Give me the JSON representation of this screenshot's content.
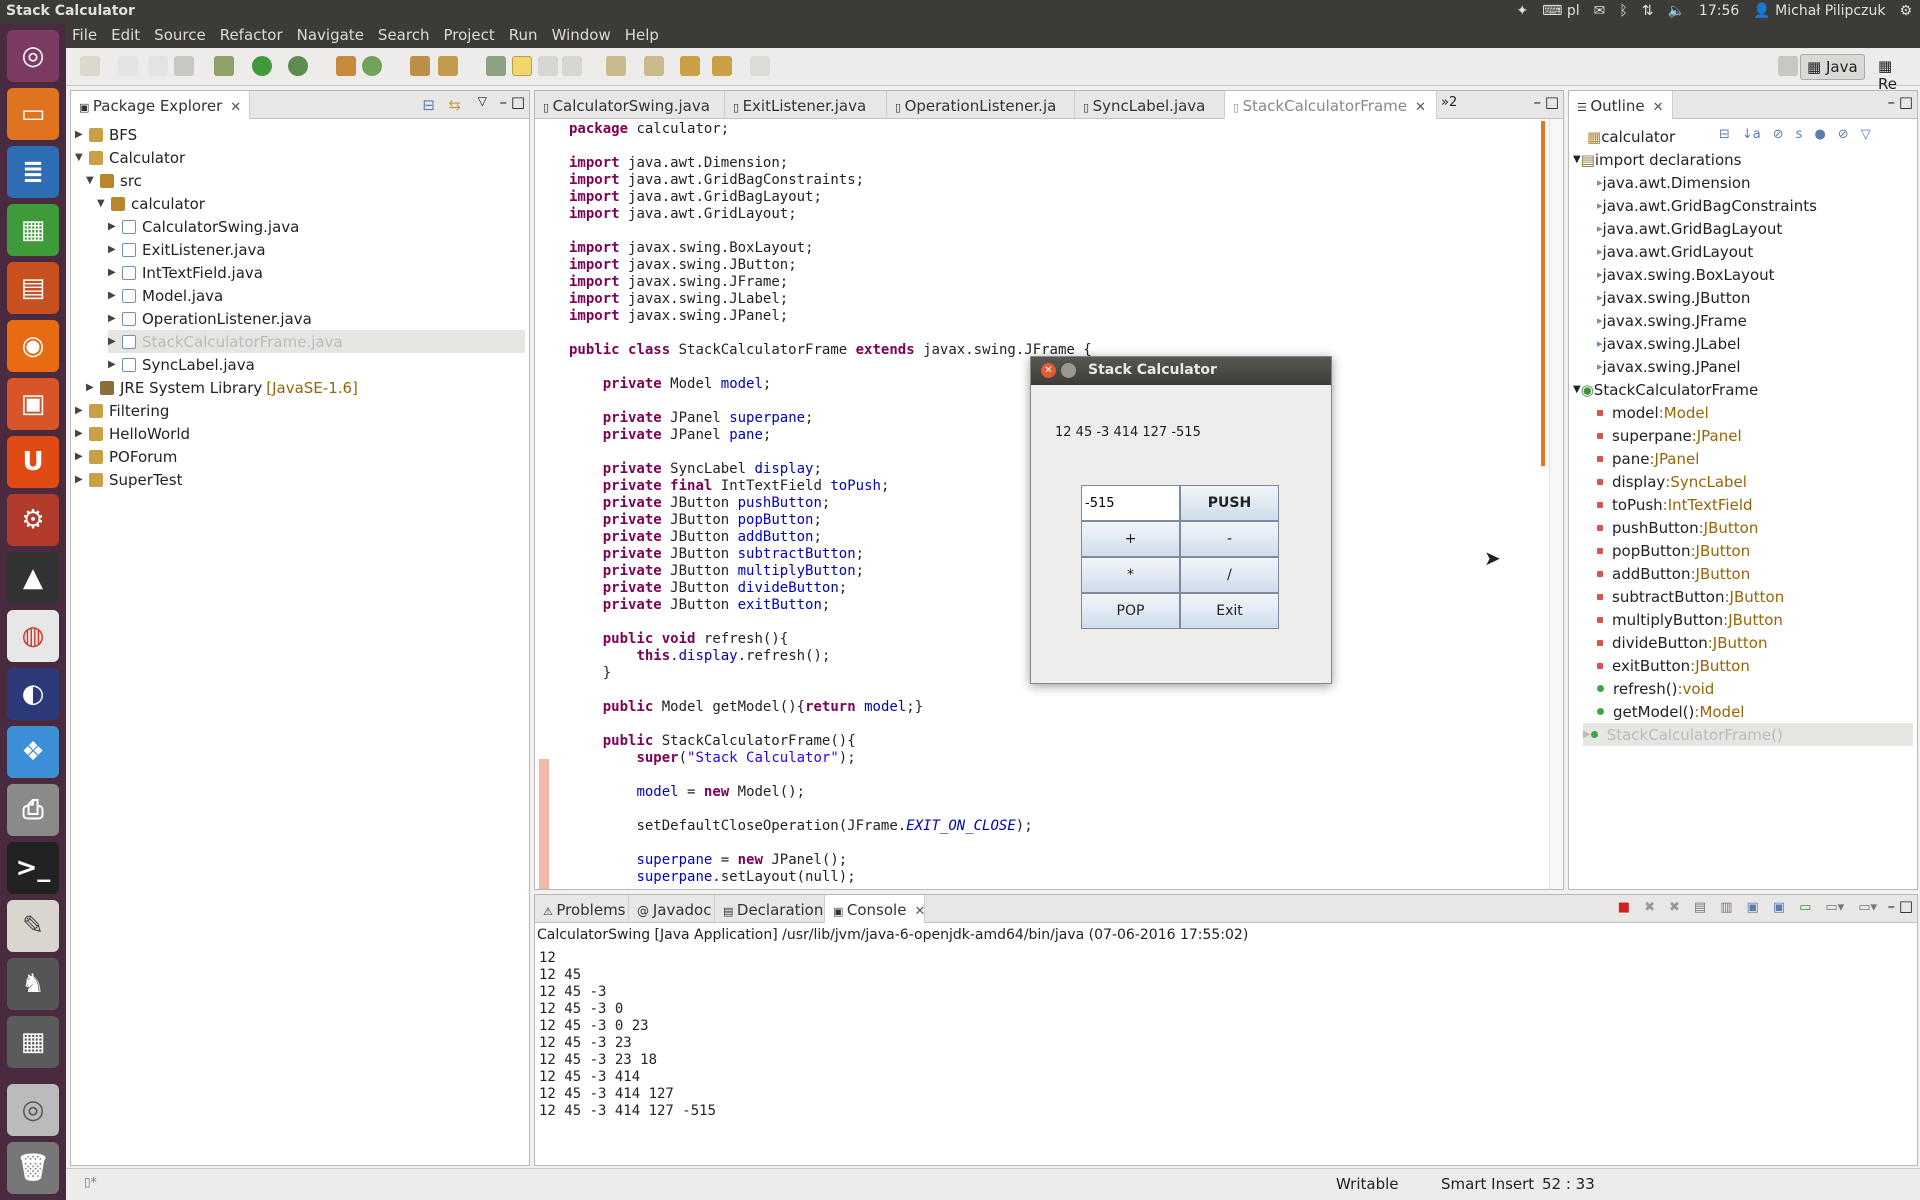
{
  "topbar": {
    "title": "Stack Calculator",
    "lang": "pl",
    "time": "17:56",
    "user": "Michał Pilipczuk"
  },
  "menu": [
    "File",
    "Edit",
    "Source",
    "Refactor",
    "Navigate",
    "Search",
    "Project",
    "Run",
    "Window",
    "Help"
  ],
  "perspectives": {
    "java": "Java",
    "re": "Re"
  },
  "package_explorer": {
    "title": "Package Explorer",
    "rows": [
      {
        "indent": 0,
        "tw": "▶",
        "icon": "proj",
        "label": "BFS"
      },
      {
        "indent": 0,
        "tw": "▼",
        "icon": "proj",
        "label": "Calculator"
      },
      {
        "indent": 1,
        "tw": "▼",
        "icon": "pkg",
        "label": "src"
      },
      {
        "indent": 2,
        "tw": "▼",
        "icon": "pkg",
        "label": "calculator"
      },
      {
        "indent": 3,
        "tw": "▶",
        "icon": "java",
        "label": "CalculatorSwing.java"
      },
      {
        "indent": 3,
        "tw": "▶",
        "icon": "java",
        "label": "ExitListener.java"
      },
      {
        "indent": 3,
        "tw": "▶",
        "icon": "java",
        "label": "IntTextField.java"
      },
      {
        "indent": 3,
        "tw": "▶",
        "icon": "java",
        "label": "Model.java"
      },
      {
        "indent": 3,
        "tw": "▶",
        "icon": "java",
        "label": "OperationListener.java"
      },
      {
        "indent": 3,
        "tw": "▶",
        "icon": "java",
        "label": "StackCalculatorFrame.java",
        "selected": true
      },
      {
        "indent": 3,
        "tw": "▶",
        "icon": "java",
        "label": "SyncLabel.java"
      },
      {
        "indent": 1,
        "tw": "▶",
        "icon": "lib",
        "label": "JRE System Library",
        "suffix": "[JavaSE-1.6]"
      },
      {
        "indent": 0,
        "tw": "▶",
        "icon": "proj",
        "label": "Filtering"
      },
      {
        "indent": 0,
        "tw": "▶",
        "icon": "proj",
        "label": "HelloWorld"
      },
      {
        "indent": 0,
        "tw": "▶",
        "icon": "proj",
        "label": "POForum"
      },
      {
        "indent": 0,
        "tw": "▶",
        "icon": "proj",
        "label": "SuperTest"
      }
    ]
  },
  "editor_tabs": [
    "CalculatorSwing.java",
    "ExitListener.java",
    "OperationListener.ja",
    "SyncLabel.java",
    "StackCalculatorFrame"
  ],
  "editor_more": "»2",
  "code_lines": [
    "package calculator;",
    "",
    "import java.awt.Dimension;",
    "import java.awt.GridBagConstraints;",
    "import java.awt.GridBagLayout;",
    "import java.awt.GridLayout;",
    "",
    "import javax.swing.BoxLayout;",
    "import javax.swing.JButton;",
    "import javax.swing.JFrame;",
    "import javax.swing.JLabel;",
    "import javax.swing.JPanel;",
    "",
    "public class StackCalculatorFrame extends javax.swing.JFrame {",
    "",
    "    private Model model;",
    "",
    "    private JPanel superpane;",
    "    private JPanel pane;",
    "",
    "    private SyncLabel display;",
    "    private final IntTextField toPush;",
    "    private JButton pushButton;",
    "    private JButton popButton;",
    "    private JButton addButton;",
    "    private JButton subtractButton;",
    "    private JButton multiplyButton;",
    "    private JButton divideButton;",
    "    private JButton exitButton;",
    "",
    "    public void refresh(){",
    "        this.display.refresh();",
    "    }",
    "",
    "    public Model getModel(){return model;}",
    "",
    "    public StackCalculatorFrame(){",
    "        super(\"Stack Calculator\");",
    "",
    "        model = new Model();",
    "",
    "        setDefaultCloseOperation(JFrame.EXIT_ON_CLOSE);",
    "",
    "        superpane = new JPanel();",
    "        superpane.setLayout(null);"
  ],
  "dialog": {
    "title": "Stack Calculator",
    "display": "12 45 -3 414 127 -515",
    "input_value": "-515",
    "buttons": {
      "push": "PUSH",
      "add": "+",
      "sub": "-",
      "mul": "*",
      "div": "/",
      "pop": "POP",
      "exit": "Exit"
    }
  },
  "outline": {
    "title": "Outline",
    "package": "calculator",
    "imports_label": "import declarations",
    "imports": [
      "java.awt.Dimension",
      "java.awt.GridBagConstraints",
      "java.awt.GridBagLayout",
      "java.awt.GridLayout",
      "javax.swing.BoxLayout",
      "javax.swing.JButton",
      "javax.swing.JFrame",
      "javax.swing.JLabel",
      "javax.swing.JPanel"
    ],
    "class_name": "StackCalculatorFrame",
    "members": [
      {
        "name": "model",
        "type": "Model",
        "kind": "field"
      },
      {
        "name": "superpane",
        "type": "JPanel",
        "kind": "field"
      },
      {
        "name": "pane",
        "type": "JPanel",
        "kind": "field"
      },
      {
        "name": "display",
        "type": "SyncLabel",
        "kind": "field"
      },
      {
        "name": "toPush",
        "type": "IntTextField",
        "kind": "final"
      },
      {
        "name": "pushButton",
        "type": "JButton",
        "kind": "field"
      },
      {
        "name": "popButton",
        "type": "JButton",
        "kind": "field"
      },
      {
        "name": "addButton",
        "type": "JButton",
        "kind": "field"
      },
      {
        "name": "subtractButton",
        "type": "JButton",
        "kind": "field"
      },
      {
        "name": "multiplyButton",
        "type": "JButton",
        "kind": "field"
      },
      {
        "name": "divideButton",
        "type": "JButton",
        "kind": "field"
      },
      {
        "name": "exitButton",
        "type": "JButton",
        "kind": "field"
      },
      {
        "name": "refresh()",
        "type": "void",
        "kind": "method"
      },
      {
        "name": "getModel()",
        "type": "Model",
        "kind": "method"
      },
      {
        "name": "StackCalculatorFrame()",
        "type": "",
        "kind": "ctor"
      }
    ]
  },
  "bottom_tabs": [
    "Problems",
    "Javadoc",
    "Declaration",
    "Console"
  ],
  "console": {
    "header": "CalculatorSwing [Java Application] /usr/lib/jvm/java-6-openjdk-amd64/bin/java (07-06-2016 17:55:02)",
    "lines": [
      "12",
      "12 45",
      "12 45 -3",
      "12 45 -3 0",
      "12 45 -3 0 23",
      "12 45 -3 23",
      "12 45 -3 23 18",
      "12 45 -3 414",
      "12 45 -3 414 127",
      "12 45 -3 414 127 -515"
    ]
  },
  "status": {
    "writable": "Writable",
    "insert": "Smart Insert",
    "position": "52 : 33"
  },
  "colors": {
    "accent": "#e9731f",
    "launcher": "#4a2a3e",
    "keyword": "#7f0055",
    "field": "#0000c0"
  }
}
